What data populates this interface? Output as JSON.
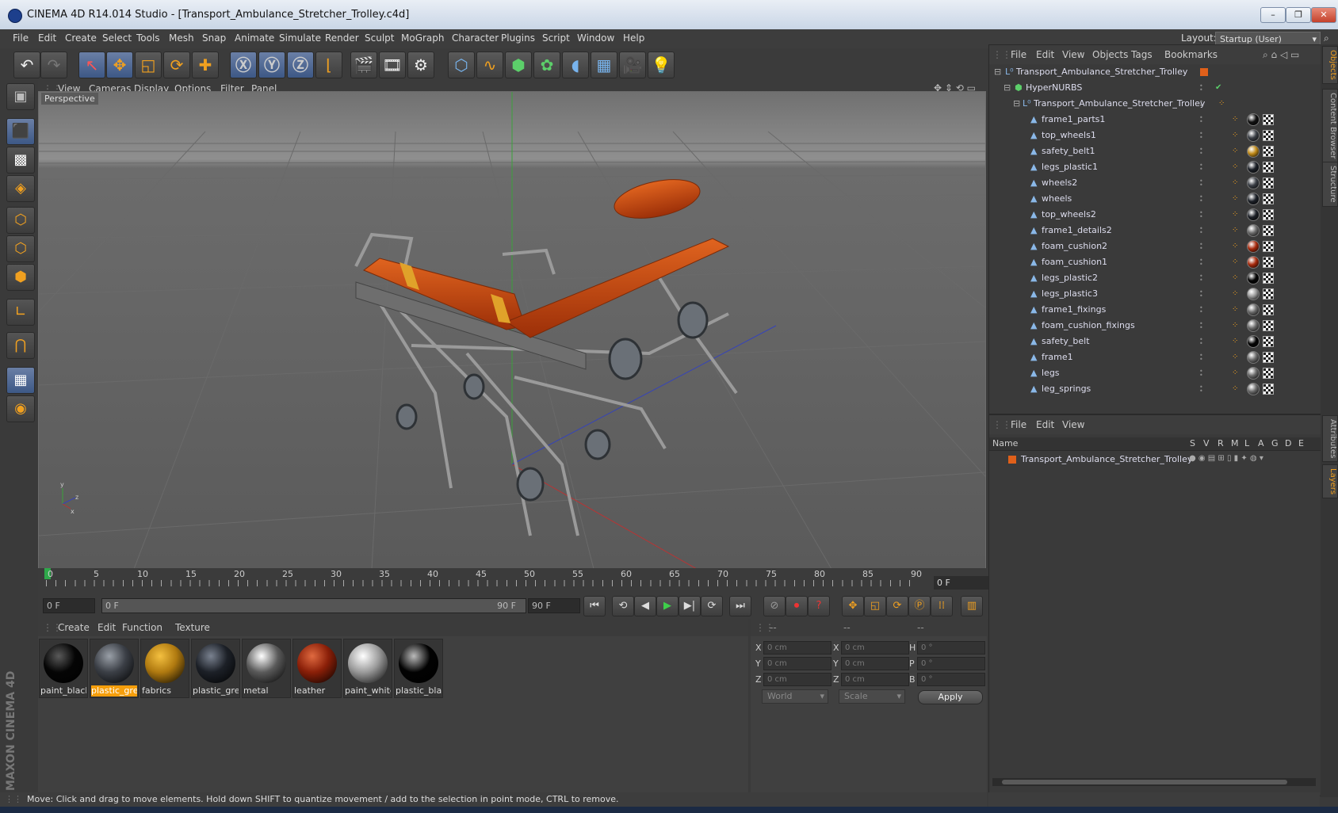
{
  "window": {
    "title": "CINEMA 4D R14.014 Studio - [Transport_Ambulance_Stretcher_Trolley.c4d]",
    "controls": {
      "minimize": "–",
      "maximize": "❐",
      "close": "✕"
    }
  },
  "menubar": {
    "items": [
      "File",
      "Edit",
      "Create",
      "Select",
      "Tools",
      "Mesh",
      "Snap",
      "Animate",
      "Simulate",
      "Render",
      "Sculpt",
      "MoGraph",
      "Character",
      "Plugins",
      "Script",
      "Window",
      "Help"
    ],
    "layout_label": "Layout:",
    "layout_value": "Startup (User)"
  },
  "viewport": {
    "menu": [
      "View",
      "Cameras",
      "Display",
      "Options",
      "Filter",
      "Panel"
    ],
    "label": "Perspective",
    "axes": {
      "x": "x",
      "y": "y",
      "z": "z"
    }
  },
  "timeline": {
    "ticks": [
      "0",
      "5",
      "10",
      "15",
      "20",
      "25",
      "30",
      "35",
      "40",
      "45",
      "50",
      "55",
      "60",
      "65",
      "70",
      "75",
      "80",
      "85",
      "90"
    ],
    "current_frame": "0 F",
    "start_field": "0 F",
    "range_start": "0 F",
    "range_end": "90 F",
    "end_field": "90 F"
  },
  "material_manager": {
    "menu": [
      "Create",
      "Edit",
      "Function",
      "Texture"
    ],
    "materials": [
      {
        "label": "paint_black",
        "color": "#050505",
        "hl": "#5a5a5a",
        "selected": false
      },
      {
        "label": "plastic_grey",
        "color": "#3b3f46",
        "hl": "#9aa0a8",
        "selected": true
      },
      {
        "label": "fabrics",
        "color": "#b07a10",
        "hl": "#f4c040",
        "selected": false
      },
      {
        "label": "plastic_grey",
        "color": "#1c2027",
        "hl": "#7a8290",
        "selected": false
      },
      {
        "label": "metal",
        "color": "#5a5a5a",
        "hl": "#ffffff",
        "selected": false
      },
      {
        "label": "leather",
        "color": "#8a1f08",
        "hl": "#e06a40",
        "selected": false
      },
      {
        "label": "paint_white",
        "color": "#9a9a9a",
        "hl": "#ffffff",
        "selected": false
      },
      {
        "label": "plastic_black",
        "color": "#020202",
        "hl": "#bbbbbb",
        "selected": false
      }
    ]
  },
  "coords": {
    "headers": [
      "--",
      "--",
      "--"
    ],
    "rows": [
      {
        "a": "X",
        "av": "0 cm",
        "b": "X",
        "bv": "0 cm",
        "c": "H",
        "cv": "0 °"
      },
      {
        "a": "Y",
        "av": "0 cm",
        "b": "Y",
        "bv": "0 cm",
        "c": "P",
        "cv": "0 °"
      },
      {
        "a": "Z",
        "av": "0 cm",
        "b": "Z",
        "bv": "0 cm",
        "c": "B",
        "cv": "0 °"
      }
    ],
    "mode": "World",
    "transform": "Scale",
    "apply": "Apply"
  },
  "object_manager": {
    "menu": [
      "File",
      "Edit",
      "View",
      "Objects",
      "Tags",
      "Bookmarks"
    ],
    "root": "Transport_Ambulance_Stretcher_Trolley",
    "hypernurbs": "HyperNURBS",
    "group": "Transport_Ambulance_Stretcher_Trolley",
    "objects": [
      {
        "name": "frame1_parts1",
        "mat": "#111111"
      },
      {
        "name": "top_wheels1",
        "mat": "#3b3f46"
      },
      {
        "name": "safety_belt1",
        "mat": "#c08a18"
      },
      {
        "name": "legs_plastic1",
        "mat": "#1c2027"
      },
      {
        "name": "wheels2",
        "mat": "#3b3f46"
      },
      {
        "name": "wheels",
        "mat": "#1c2027"
      },
      {
        "name": "top_wheels2",
        "mat": "#1c2027"
      },
      {
        "name": "frame1_details2",
        "mat": "#6a6a6a"
      },
      {
        "name": "foam_cushion2",
        "mat": "#a82a0c"
      },
      {
        "name": "foam_cushion1",
        "mat": "#a82a0c"
      },
      {
        "name": "legs_plastic2",
        "mat": "#050505"
      },
      {
        "name": "legs_plastic3",
        "mat": "#9a9a9a"
      },
      {
        "name": "frame1_fixings",
        "mat": "#6a6a6a"
      },
      {
        "name": "foam_cushion_fixings",
        "mat": "#6a6a6a"
      },
      {
        "name": "safety_belt",
        "mat": "#050505"
      },
      {
        "name": "frame1",
        "mat": "#6a6a6a"
      },
      {
        "name": "legs",
        "mat": "#6a6a6a"
      },
      {
        "name": "leg_springs",
        "mat": "#6a6a6a"
      }
    ]
  },
  "layer_manager": {
    "menu": [
      "File",
      "Edit",
      "View"
    ],
    "columns": [
      "Name",
      "S",
      "V",
      "R",
      "M",
      "L",
      "A",
      "G",
      "D",
      "E"
    ],
    "layers": [
      {
        "name": "Transport_Ambulance_Stretcher_Trolley",
        "color": "#e0601a"
      }
    ]
  },
  "right_tabs": [
    "Objects",
    "Content Browser",
    "Structure",
    "Attributes",
    "Layers"
  ],
  "status": "Move: Click and drag to move elements. Hold down SHIFT to quantize movement / add to the selection in point mode, CTRL to remove.",
  "branding": "MAXON CINEMA 4D"
}
